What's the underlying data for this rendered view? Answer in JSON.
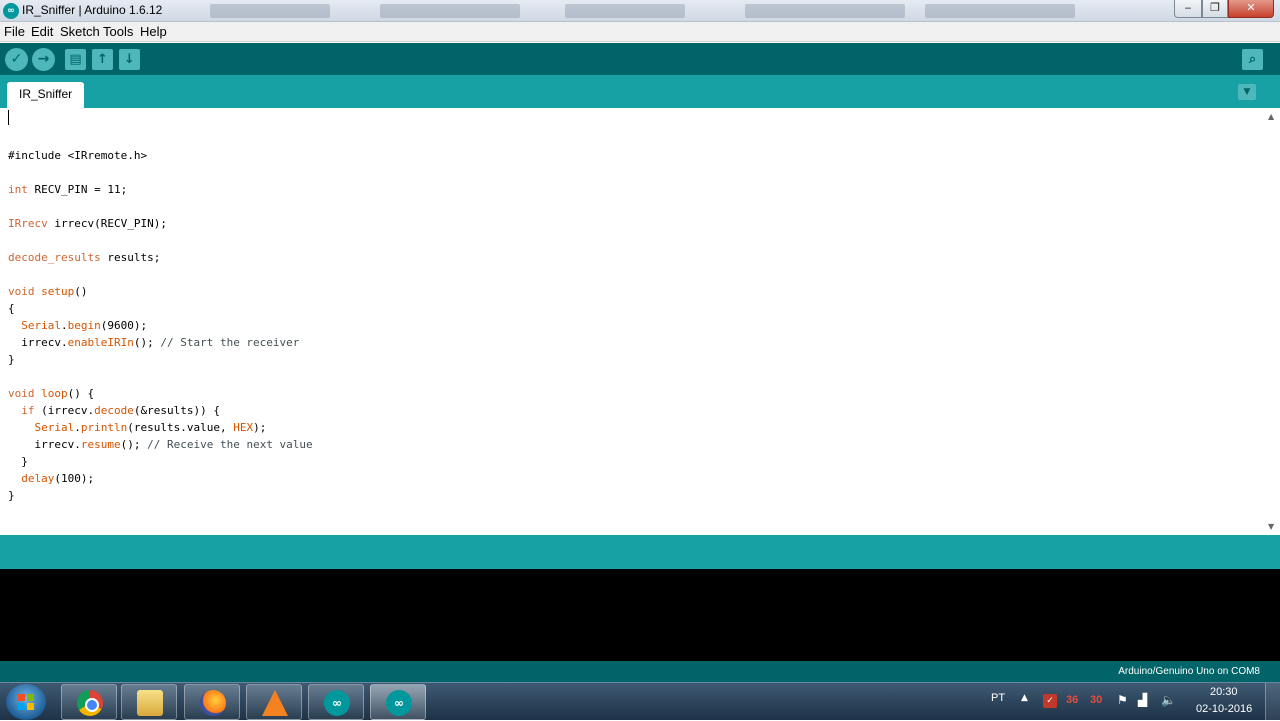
{
  "window": {
    "title": "IR_Sniffer | Arduino 1.6.12",
    "controls": {
      "minimize": "‒",
      "maximize": "❐",
      "close": "✕"
    }
  },
  "menu": [
    "File",
    "Edit",
    "Sketch",
    "Tools",
    "Help"
  ],
  "toolbar": {
    "verify": "✓",
    "upload": "→",
    "new": "▤",
    "open": "↑",
    "save": "↓",
    "serial_monitor": "⌕"
  },
  "tabs": [
    {
      "label": "IR_Sniffer",
      "active": true
    }
  ],
  "tab_menu": "▼",
  "code_lines": [
    [],
    [],
    [
      {
        "t": "#include <IRremote.h>",
        "c": ""
      }
    ],
    [],
    [
      {
        "t": "int",
        "c": "kw"
      },
      {
        "t": " RECV_PIN = 11;",
        "c": ""
      }
    ],
    [],
    [
      {
        "t": "IRrecv",
        "c": "kw"
      },
      {
        "t": " irrecv(RECV_PIN);",
        "c": ""
      }
    ],
    [],
    [
      {
        "t": "decode_results",
        "c": "kw"
      },
      {
        "t": " results;",
        "c": ""
      }
    ],
    [],
    [
      {
        "t": "void",
        "c": "kw"
      },
      {
        "t": " ",
        "c": ""
      },
      {
        "t": "setup",
        "c": "kw2"
      },
      {
        "t": "()",
        "c": ""
      }
    ],
    [
      {
        "t": "{",
        "c": ""
      }
    ],
    [
      {
        "t": "  ",
        "c": ""
      },
      {
        "t": "Serial",
        "c": "kw2"
      },
      {
        "t": ".",
        "c": ""
      },
      {
        "t": "begin",
        "c": "kw2"
      },
      {
        "t": "(9600);",
        "c": ""
      }
    ],
    [
      {
        "t": "  irrecv.",
        "c": ""
      },
      {
        "t": "enableIRIn",
        "c": "kw2"
      },
      {
        "t": "(); ",
        "c": ""
      },
      {
        "t": "// Start the receiver",
        "c": "cmt"
      }
    ],
    [
      {
        "t": "}",
        "c": ""
      }
    ],
    [],
    [
      {
        "t": "void",
        "c": "kw"
      },
      {
        "t": " ",
        "c": ""
      },
      {
        "t": "loop",
        "c": "kw2"
      },
      {
        "t": "() {",
        "c": ""
      }
    ],
    [
      {
        "t": "  ",
        "c": ""
      },
      {
        "t": "if",
        "c": "kw"
      },
      {
        "t": " (irrecv.",
        "c": ""
      },
      {
        "t": "decode",
        "c": "kw2"
      },
      {
        "t": "(&results)) {",
        "c": ""
      }
    ],
    [
      {
        "t": "    ",
        "c": ""
      },
      {
        "t": "Serial",
        "c": "kw2"
      },
      {
        "t": ".",
        "c": ""
      },
      {
        "t": "println",
        "c": "kw2"
      },
      {
        "t": "(results.value, ",
        "c": ""
      },
      {
        "t": "HEX",
        "c": "kw2"
      },
      {
        "t": ");",
        "c": ""
      }
    ],
    [
      {
        "t": "    irrecv.",
        "c": ""
      },
      {
        "t": "resume",
        "c": "kw2"
      },
      {
        "t": "(); ",
        "c": ""
      },
      {
        "t": "// Receive the next value",
        "c": "cmt"
      }
    ],
    [
      {
        "t": "  }",
        "c": ""
      }
    ],
    [
      {
        "t": "  ",
        "c": ""
      },
      {
        "t": "delay",
        "c": "kw2"
      },
      {
        "t": "(100);",
        "c": ""
      }
    ],
    [
      {
        "t": "}",
        "c": ""
      }
    ]
  ],
  "status": {
    "board": "Arduino/Genuino Uno on COM8"
  },
  "taskbar": {
    "apps": [
      "chrome",
      "explorer",
      "firefox",
      "vlc",
      "arduino",
      "arduino"
    ],
    "tray": {
      "language": "PT",
      "antivirus_glyph": "✓",
      "counter_1": "36",
      "counter_2": "30",
      "time": "20:30",
      "date": "02-10-2016"
    }
  },
  "colors": {
    "toolbar": "#006468",
    "tabbar": "#17a1a5",
    "keyword": "#cc6633",
    "function": "#d35400",
    "comment": "#434f54"
  }
}
